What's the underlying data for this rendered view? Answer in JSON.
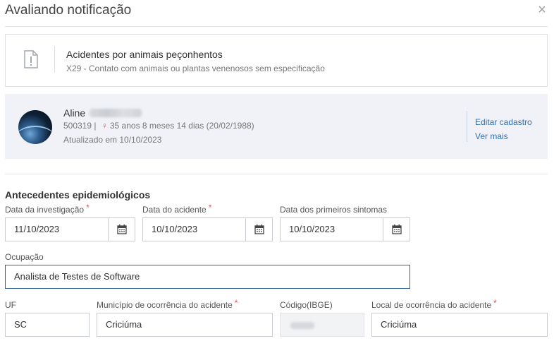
{
  "modal": {
    "title": "Avaliando notificação",
    "close_glyph": "×"
  },
  "notification": {
    "icon": "document-alert-icon",
    "name": "Acidentes por animais peçonhentos",
    "code_description": "X29 - Contato com animais ou plantas venenosos sem especificação"
  },
  "patient": {
    "first_name": "Aline",
    "id": "500319",
    "separator": "|",
    "sex_icon": "female-icon",
    "age": "35 anos 8 meses 14 dias (20/02/1988)",
    "updated": "Atualizado em 10/10/2023",
    "edit_link": "Editar cadastro",
    "more_link": "Ver mais"
  },
  "section": {
    "title": "Antecedentes epidemiológicos"
  },
  "form": {
    "data_investigacao": {
      "label": "Data da investigação",
      "value": "11/10/2023",
      "required": "*"
    },
    "data_acidente": {
      "label": "Data do acidente",
      "value": "10/10/2023",
      "required": "*"
    },
    "data_sintomas": {
      "label": "Data dos primeiros sintomas",
      "value": "10/10/2023"
    },
    "ocupacao": {
      "label": "Ocupação",
      "value": "Analista de Testes de Software"
    },
    "uf": {
      "label": "UF",
      "value": "SC"
    },
    "municipio": {
      "label": "Município de ocorrência do acidente",
      "value": "Criciúma",
      "required": "*"
    },
    "codigo_ibge": {
      "label": "Código(IBGE)"
    },
    "local": {
      "label": "Local de ocorrência do acidente",
      "value": "Criciúma",
      "required": "*"
    }
  },
  "colors": {
    "accent": "#2a5d9b",
    "link": "#2f6fb0",
    "required": "#d9534f",
    "patient_bg": "#f0f2f7"
  }
}
